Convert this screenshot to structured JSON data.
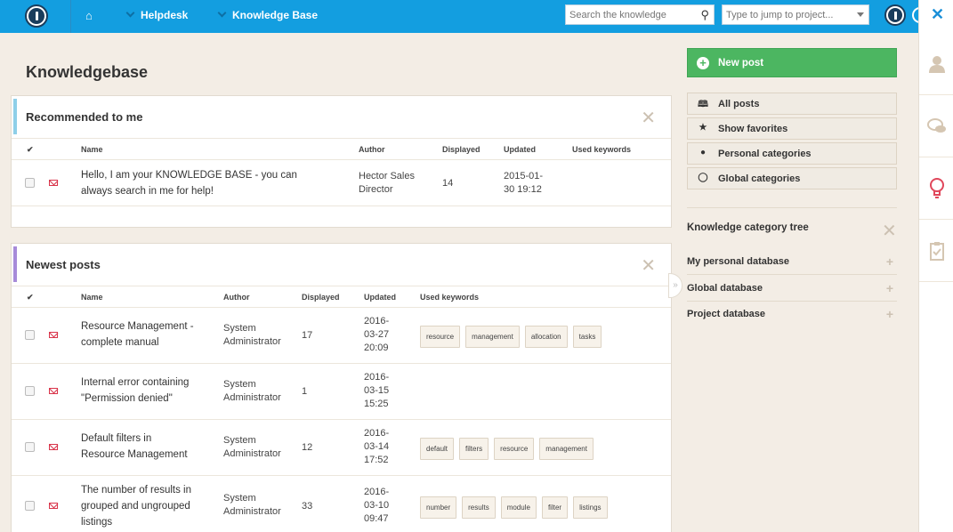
{
  "topbar": {
    "home": "⌂",
    "crumbs": [
      "Helpdesk",
      "Knowledge Base"
    ],
    "search_placeholder": "Search the knowledge",
    "jump_placeholder": "Type to jump to project..."
  },
  "page": {
    "title": "Knowledgebase"
  },
  "recommended": {
    "title": "Recommended to me",
    "columns": {
      "check": "✔",
      "name": "Name",
      "author": "Author",
      "displayed": "Displayed",
      "updated": "Updated",
      "keywords": "Used keywords"
    },
    "rows": [
      {
        "name_l1": "Hello, I am your KNOWLEDGE BASE - you can",
        "name_l2": "always search in me for help!",
        "author_l1": "Hector Sales",
        "author_l2": "Director",
        "displayed": "14",
        "updated_l1": "2015-01-",
        "updated_l2": "30 19:12"
      }
    ]
  },
  "newest": {
    "title": "Newest posts",
    "columns": {
      "check": "✔",
      "name": "Name",
      "author": "Author",
      "displayed": "Displayed",
      "updated": "Updated",
      "keywords": "Used keywords"
    },
    "rows": [
      {
        "name": [
          "Resource Management -",
          "complete manual"
        ],
        "author": [
          "System",
          "Administrator"
        ],
        "displayed": "17",
        "updated": [
          "2016-",
          "03-27",
          "20:09"
        ],
        "keywords": [
          "resource",
          "management",
          "allocation",
          "tasks"
        ]
      },
      {
        "name": [
          "Internal error containing",
          "\"Permission denied\""
        ],
        "author": [
          "System",
          "Administrator"
        ],
        "displayed": "1",
        "updated": [
          "2016-",
          "03-15",
          "15:25"
        ],
        "keywords": []
      },
      {
        "name": [
          "Default filters in",
          "Resource Management"
        ],
        "author": [
          "System",
          "Administrator"
        ],
        "displayed": "12",
        "updated": [
          "2016-",
          "03-14",
          "17:52"
        ],
        "keywords": [
          "default",
          "filters",
          "resource",
          "management"
        ]
      },
      {
        "name": [
          "The number of results in",
          "grouped and ungrouped",
          "listings"
        ],
        "author": [
          "System",
          "Administrator"
        ],
        "displayed": "33",
        "updated": [
          "2016-",
          "03-10",
          "09:47"
        ],
        "keywords": [
          "number",
          "results",
          "module",
          "filter",
          "listings"
        ]
      }
    ]
  },
  "sidebar": {
    "new_post": "New post",
    "buttons": [
      "All posts",
      "Show favorites",
      "Personal categories",
      "Global categories"
    ],
    "tree_title": "Knowledge category tree",
    "tree_items": [
      "My personal database",
      "Global database",
      "Project database"
    ]
  },
  "collapse": "»",
  "colors": {
    "topbar": "#139ee0",
    "accent_recommended": "#8ecfe8",
    "accent_newest": "#a78bd9",
    "new_post": "#4cb661"
  }
}
